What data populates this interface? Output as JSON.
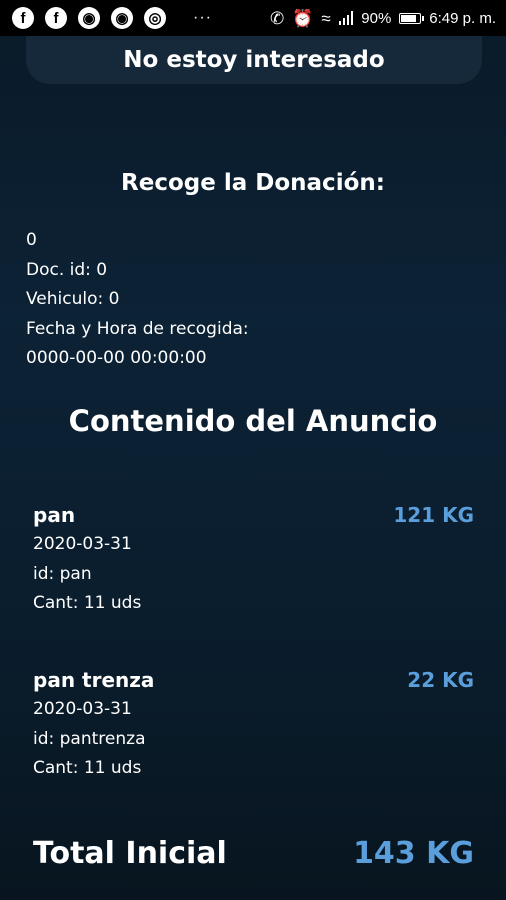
{
  "status_bar": {
    "battery": "90%",
    "time": "6:49 p. m.",
    "more": "···"
  },
  "top_button": {
    "label": "No estoy interesado"
  },
  "pickup": {
    "title": "Recoge la Donación:",
    "lines": [
      "0",
      "Doc. id: 0",
      "Vehiculo: 0",
      "Fecha y Hora de recogida:",
      "0000-00-00 00:00:00"
    ]
  },
  "content": {
    "title": "Contenido del Anuncio",
    "items": [
      {
        "name": "pan",
        "weight": "121 KG",
        "date": "2020-03-31",
        "id": "id: pan",
        "qty": "Cant: 11 uds"
      },
      {
        "name": "pan trenza",
        "weight": "22 KG",
        "date": "2020-03-31",
        "id": "id: pantrenza",
        "qty": "Cant: 11 uds"
      }
    ]
  },
  "total": {
    "label": "Total Inicial",
    "value": "143 KG"
  },
  "colors": {
    "accent": "#5a9fdb",
    "background": "#0c2235",
    "button": "#15293b"
  }
}
